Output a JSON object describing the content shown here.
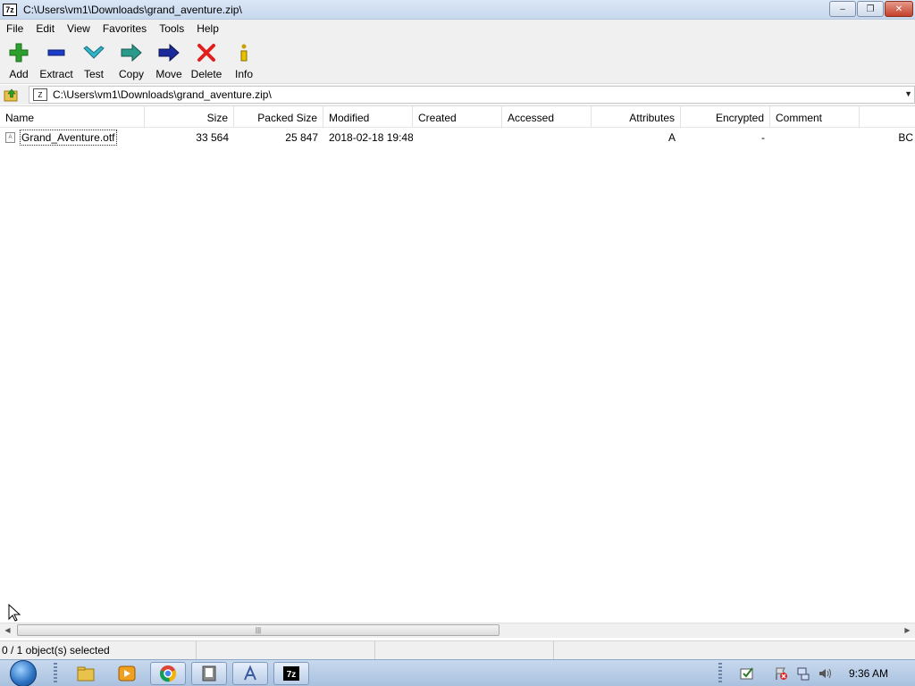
{
  "window": {
    "title": "C:\\Users\\vm1\\Downloads\\grand_aventure.zip\\",
    "app_icon_text": "7z",
    "controls": {
      "minimize": "–",
      "maximize": "❐",
      "close": "✕"
    }
  },
  "menu": [
    "File",
    "Edit",
    "View",
    "Favorites",
    "Tools",
    "Help"
  ],
  "toolbar": [
    {
      "label": "Add",
      "icon": "add-icon"
    },
    {
      "label": "Extract",
      "icon": "extract-icon"
    },
    {
      "label": "Test",
      "icon": "test-icon"
    },
    {
      "label": "Copy",
      "icon": "copy-icon"
    },
    {
      "label": "Move",
      "icon": "move-icon"
    },
    {
      "label": "Delete",
      "icon": "delete-icon"
    },
    {
      "label": "Info",
      "icon": "info-icon"
    }
  ],
  "address": {
    "icon_text": "Z",
    "path": "C:\\Users\\vm1\\Downloads\\grand_aventure.zip\\"
  },
  "columns": [
    "Name",
    "Size",
    "Packed Size",
    "Modified",
    "Created",
    "Accessed",
    "Attributes",
    "Encrypted",
    "Comment"
  ],
  "files": [
    {
      "name": "Grand_Aventure.otf",
      "size": "33 564",
      "packed_size": "25 847",
      "modified": "2018-02-18 19:48",
      "created": "",
      "accessed": "",
      "attributes": "A",
      "encrypted": "-",
      "comment": "",
      "crc": "BC"
    }
  ],
  "status": {
    "selection": "0 / 1 object(s) selected"
  },
  "taskbar": {
    "clock": "9:36 AM",
    "apps": [
      "explorer-icon",
      "media-player-icon",
      "chrome-icon",
      "archive-app-icon",
      "font-viewer-icon",
      "7zip-icon"
    ]
  },
  "colors": {
    "add": "#2ca02c",
    "extract": "#1a3cc8",
    "test": "#2fb5c9",
    "delete": "#e01e1e",
    "info": "#c8a000",
    "move": "#1a2a9a"
  }
}
